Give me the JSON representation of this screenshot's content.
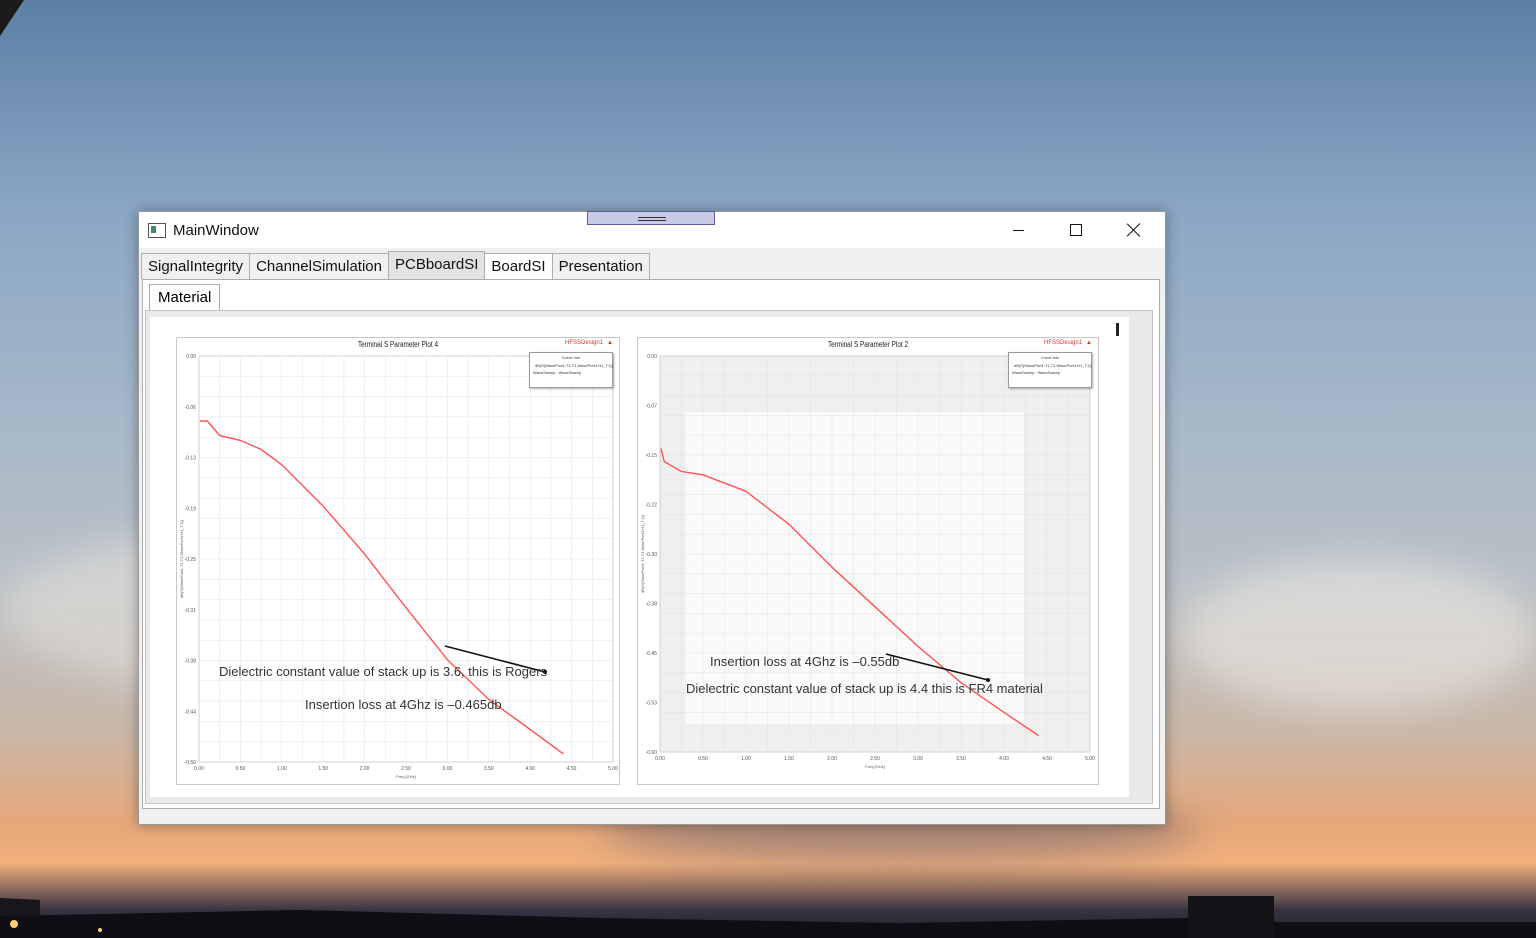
{
  "window": {
    "title": "MainWindow",
    "controls": {
      "minimize": "minimize-icon",
      "maximize": "maximize-icon",
      "close": "close-icon"
    }
  },
  "tabs": [
    "SignalIntegrity",
    "ChannelSimulation",
    "PCBboardSI",
    "BoardSI",
    "Presentation"
  ],
  "active_tab": "BoardSI",
  "sub_tab": "Material",
  "plots": [
    {
      "title": "Terminal S Parameter Plot 4",
      "tag": "HFSSDesign1",
      "legend_title": "Curve Info",
      "legend_entry": "dB(S(WavePort1:T1,T1,WavePort1:H1_T1))",
      "legend_sub": "WaveSweep : WaveSweep",
      "x_label": "Freq [GHz]",
      "y_label": "dB(S(WavePort1:T1,T1,WavePort1:H1_T1))",
      "annotation_1": "Dielectric constant value of stack up is 3.6, this is Rogers",
      "annotation_2": "Insertion loss at 4Ghz is –0.465db"
    },
    {
      "title": "Terminal S Parameter Plot 2",
      "tag": "HFSSDesign1",
      "legend_title": "Curve Info",
      "legend_entry": "dB(S(WavePort1:T1,T1,WavePort1:H1_T1))",
      "legend_sub": "WaveSweep : WaveSweep",
      "x_label": "Freq [GHz]",
      "y_label": "dB(S(WavePort1:T1,T1,WavePort1:H1_T1))",
      "annotation_1": "Insertion loss at 4Ghz is –0.55db",
      "annotation_2": "Dielectric constant value of stack up is 4.4 this is FR4 material"
    }
  ],
  "chart_data": [
    {
      "type": "line",
      "title": "Terminal S Parameter Plot 4",
      "xlabel": "Freq [GHz]",
      "ylabel": "dB(S(WavePort1:T1,T1,WavePort1:H1_T1))",
      "xlim": [
        0,
        5
      ],
      "ylim": [
        -0.5,
        0
      ],
      "grid": true,
      "legend": "top-right",
      "series": [
        {
          "name": "dB(S(WavePort1:T1,T1,WavePort1:H1_T1))",
          "x": [
            0.01,
            0.1,
            0.25,
            0.5,
            0.75,
            1.0,
            1.5,
            2.0,
            2.5,
            3.0,
            3.5,
            4.0,
            4.4
          ],
          "y": [
            -0.08,
            -0.08,
            -0.098,
            -0.104,
            -0.115,
            -0.134,
            -0.185,
            -0.244,
            -0.31,
            -0.374,
            -0.423,
            -0.46,
            -0.49
          ]
        }
      ]
    },
    {
      "type": "line",
      "title": "Terminal S Parameter Plot 2",
      "xlabel": "Freq [GHz]",
      "ylabel": "dB(S(WavePort1:T1,T1,WavePort1:H1_T1))",
      "xlim": [
        0,
        5
      ],
      "ylim": [
        -0.6,
        0
      ],
      "grid": true,
      "legend": "top-right",
      "series": [
        {
          "name": "dB(S(WavePort1:T1,T1,WavePort1:H1_T1))",
          "x": [
            0.01,
            0.05,
            0.25,
            0.5,
            1.0,
            1.5,
            2.0,
            2.5,
            3.0,
            3.5,
            4.0,
            4.4
          ],
          "y": [
            -0.14,
            -0.16,
            -0.175,
            -0.18,
            -0.205,
            -0.255,
            -0.32,
            -0.38,
            -0.44,
            -0.495,
            -0.54,
            -0.575
          ]
        }
      ]
    }
  ]
}
